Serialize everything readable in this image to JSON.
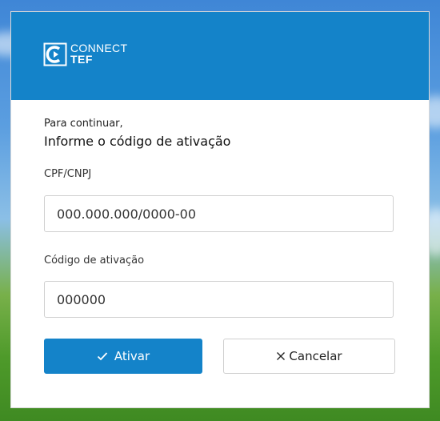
{
  "brand": {
    "line1": "CONNECT",
    "line2": "TEF",
    "header_color": "#1483c9"
  },
  "form": {
    "intro": "Para continuar,",
    "heading": "Informe o código de ativação",
    "cpf_label": "CPF/CNPJ",
    "cpf_placeholder": "000.000.000/0000-00",
    "code_label": "Código de ativação",
    "code_placeholder": "000000"
  },
  "buttons": {
    "activate_label": "Ativar",
    "activate_icon": "check-icon",
    "cancel_label": "Cancelar",
    "cancel_icon": "close-icon"
  }
}
